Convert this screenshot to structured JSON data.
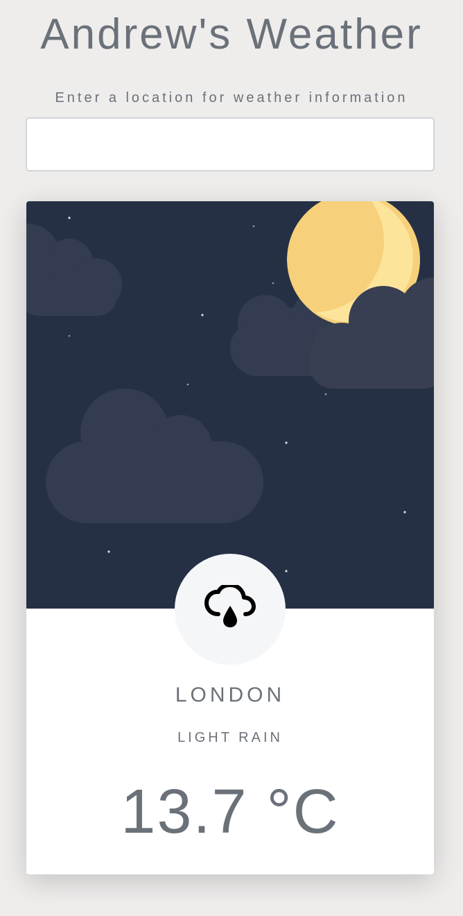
{
  "header": {
    "title": "Andrew's Weather"
  },
  "search": {
    "label": "Enter a location for weather information",
    "value": "",
    "placeholder": ""
  },
  "weather": {
    "city": "LONDON",
    "condition": "LIGHT RAIN",
    "temperature": "13.7 °C",
    "icon": "cloud-rain-icon",
    "scene": "night-moon-clouds-stars"
  },
  "colors": {
    "page_background": "#eeedec",
    "text": "#6b7179",
    "sky": "#263045",
    "cloud": "#333c50",
    "moon": "#fce49b",
    "moon_shadow": "#f6d07a",
    "card": "#ffffff",
    "icon_badge": "#f4f6f8"
  }
}
